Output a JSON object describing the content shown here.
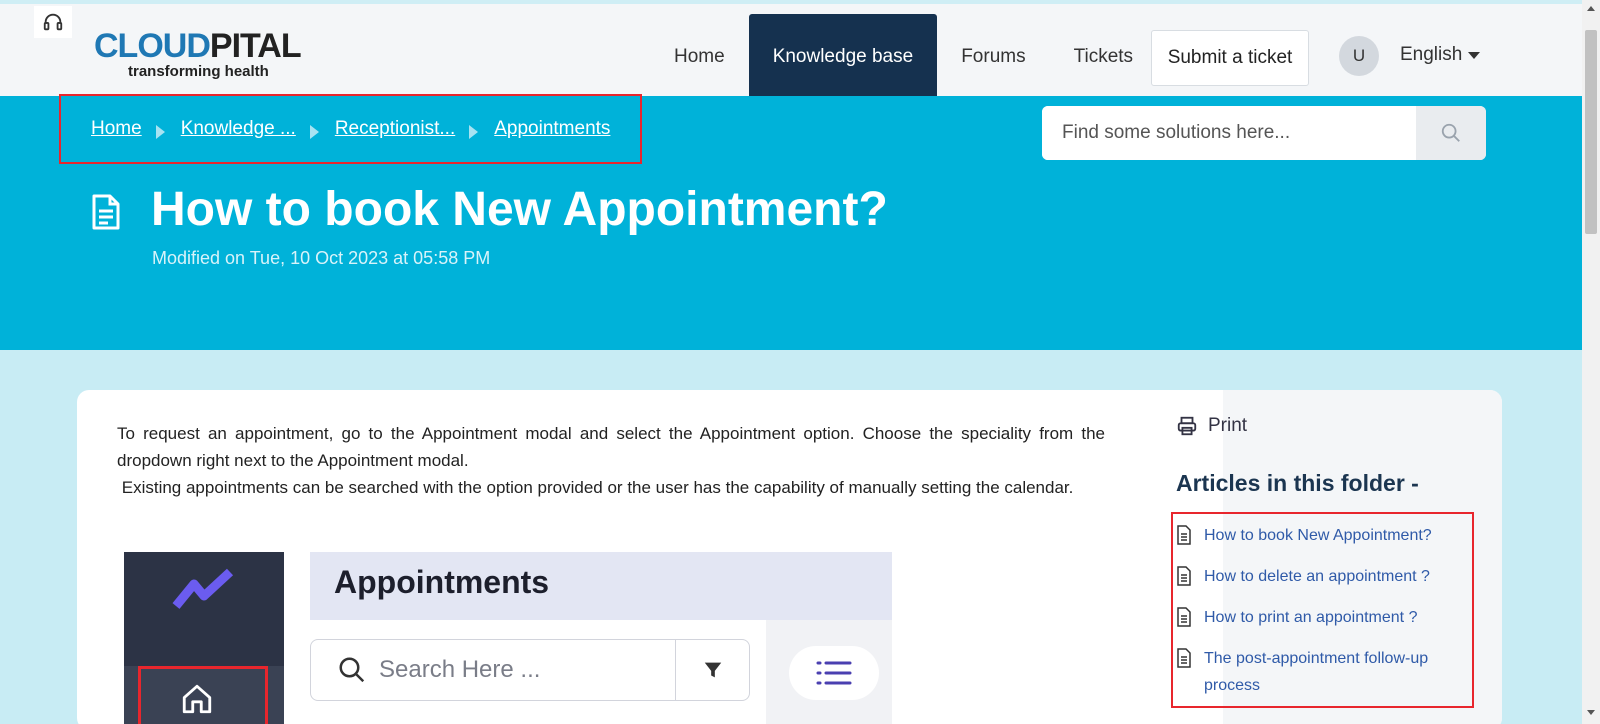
{
  "header": {
    "logo": {
      "part1": "CLOUD",
      "part2": "PITAL",
      "tagline": "transforming health"
    },
    "nav": [
      {
        "label": "Home"
      },
      {
        "label": "Knowledge base"
      },
      {
        "label": "Forums"
      },
      {
        "label": "Tickets"
      }
    ],
    "submit_ticket": "Submit a ticket",
    "avatar_initial": "U",
    "language": "English"
  },
  "breadcrumb": [
    "Home",
    "Knowledge ...",
    "Receptionist...",
    "Appointments"
  ],
  "search": {
    "placeholder": "Find some solutions here..."
  },
  "article": {
    "title": "How to book New Appointment?",
    "modified": "Modified on Tue, 10 Oct 2023 at 05:58 PM",
    "paragraphs": [
      "To request an appointment, go to the Appointment modal and select the Appointment option. Choose the speciality from the dropdown right next to the Appointment modal.",
      "Existing appointments can be searched with the option provided or the user has the capability of manually setting the calendar."
    ],
    "screenshot": {
      "title": "Appointments",
      "search_placeholder": "Search Here ..."
    }
  },
  "aside": {
    "print": "Print",
    "folder_title": "Articles in this folder -",
    "articles": [
      "How to book New Appointment?",
      "How to delete an appointment ?",
      "How to print an appointment ?",
      "The post-appointment follow-up process"
    ]
  },
  "colors": {
    "hero": "#00b2d9",
    "nav_active": "#15314f",
    "highlight_box": "#e8262d",
    "link": "#2f5aa8"
  }
}
